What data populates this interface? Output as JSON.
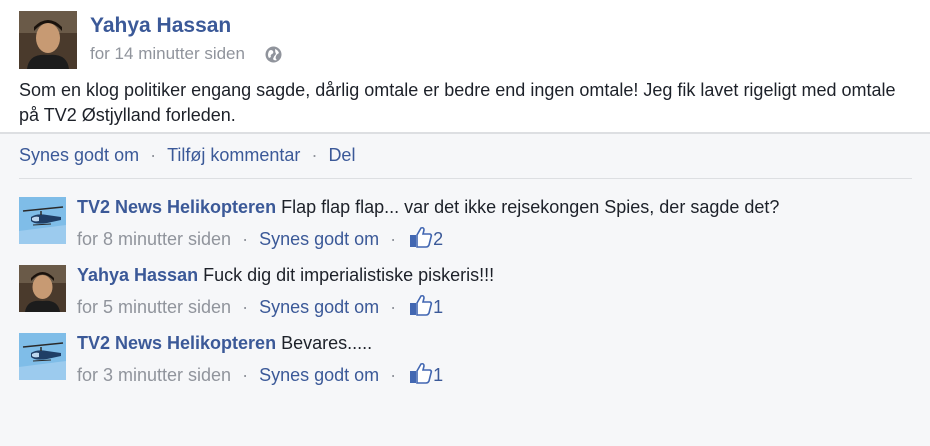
{
  "post": {
    "author": "Yahya Hassan",
    "timestamp": "for 14 minutter siden",
    "privacy_icon": "globe-icon",
    "text": "Som en klog politiker engang sagde, dårlig omtale er bedre end ingen omtale! Jeg fik lavet rigeligt med omtale på TV2 Østjylland forleden."
  },
  "actions": {
    "like": "Synes godt om",
    "comment": "Tilføj kommentar",
    "share": "Del",
    "separator": "·"
  },
  "comments": [
    {
      "author": "TV2 News Helikopteren",
      "text": "Flap flap flap...  var det ikke rejsekongen Spies, der sagde det?",
      "timestamp": "for 8 minutter siden",
      "like_label": "Synes godt om",
      "like_count": "2",
      "avatar": "helicopter"
    },
    {
      "author": "Yahya Hassan",
      "text": "Fuck dig dit imperialistiske piskeris!!!",
      "timestamp": "for 5 minutter siden",
      "like_label": "Synes godt om",
      "like_count": "1",
      "avatar": "person"
    },
    {
      "author": "TV2 News Helikopteren",
      "text": "Bevares.....",
      "timestamp": "for 3 minutter siden",
      "like_label": "Synes godt om",
      "like_count": "1",
      "avatar": "helicopter"
    }
  ],
  "colors": {
    "link": "#3b5998",
    "muted": "#90949c",
    "background": "#f6f7f9"
  }
}
